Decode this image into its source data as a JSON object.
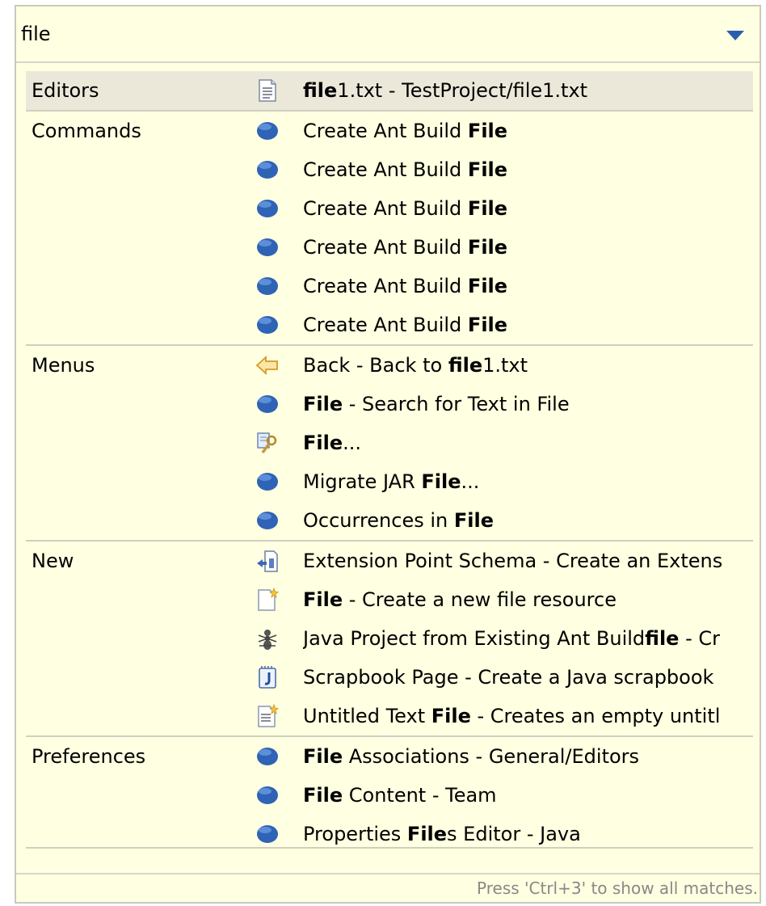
{
  "filter": {
    "value": "file"
  },
  "rows": [
    {
      "category": "Editors",
      "icon": "text-file-icon",
      "selected": true,
      "sep": false,
      "parts": [
        {
          "t": "file",
          "b": true
        },
        {
          "t": "1.txt - TestProject/file1.txt",
          "b": false
        }
      ]
    },
    {
      "category": "Commands",
      "icon": "blue-dot-icon",
      "selected": false,
      "sep": true,
      "parts": [
        {
          "t": "Create Ant Build ",
          "b": false
        },
        {
          "t": "File",
          "b": true
        }
      ]
    },
    {
      "category": "",
      "icon": "blue-dot-icon",
      "selected": false,
      "sep": false,
      "parts": [
        {
          "t": "Create Ant Build ",
          "b": false
        },
        {
          "t": "File",
          "b": true
        }
      ]
    },
    {
      "category": "",
      "icon": "blue-dot-icon",
      "selected": false,
      "sep": false,
      "parts": [
        {
          "t": "Create Ant Build ",
          "b": false
        },
        {
          "t": "File",
          "b": true
        }
      ]
    },
    {
      "category": "",
      "icon": "blue-dot-icon",
      "selected": false,
      "sep": false,
      "parts": [
        {
          "t": "Create Ant Build ",
          "b": false
        },
        {
          "t": "File",
          "b": true
        }
      ]
    },
    {
      "category": "",
      "icon": "blue-dot-icon",
      "selected": false,
      "sep": false,
      "parts": [
        {
          "t": "Create Ant Build ",
          "b": false
        },
        {
          "t": "File",
          "b": true
        }
      ]
    },
    {
      "category": "",
      "icon": "blue-dot-icon",
      "selected": false,
      "sep": false,
      "parts": [
        {
          "t": "Create Ant Build ",
          "b": false
        },
        {
          "t": "File",
          "b": true
        }
      ]
    },
    {
      "category": "Menus",
      "icon": "back-arrow-icon",
      "selected": false,
      "sep": true,
      "parts": [
        {
          "t": "Back - Back to ",
          "b": false
        },
        {
          "t": "file",
          "b": true
        },
        {
          "t": "1.txt",
          "b": false
        }
      ]
    },
    {
      "category": "",
      "icon": "blue-dot-icon",
      "selected": false,
      "sep": false,
      "parts": [
        {
          "t": "File",
          "b": true
        },
        {
          "t": " - Search for Text in File",
          "b": false
        }
      ]
    },
    {
      "category": "",
      "icon": "file-search-icon",
      "selected": false,
      "sep": false,
      "parts": [
        {
          "t": "File",
          "b": true
        },
        {
          "t": "...",
          "b": false
        }
      ]
    },
    {
      "category": "",
      "icon": "blue-dot-icon",
      "selected": false,
      "sep": false,
      "parts": [
        {
          "t": "Migrate JAR ",
          "b": false
        },
        {
          "t": "File",
          "b": true
        },
        {
          "t": "...",
          "b": false
        }
      ]
    },
    {
      "category": "",
      "icon": "blue-dot-icon",
      "selected": false,
      "sep": false,
      "parts": [
        {
          "t": "Occurrences in ",
          "b": false
        },
        {
          "t": "File",
          "b": true
        }
      ]
    },
    {
      "category": "New",
      "icon": "extension-point-icon",
      "selected": false,
      "sep": true,
      "parts": [
        {
          "t": "Extension Point Schema - Create an Extens",
          "b": false
        }
      ]
    },
    {
      "category": "",
      "icon": "new-file-icon",
      "selected": false,
      "sep": false,
      "parts": [
        {
          "t": "File",
          "b": true
        },
        {
          "t": " - Create a new file resource",
          "b": false
        }
      ]
    },
    {
      "category": "",
      "icon": "ant-icon",
      "selected": false,
      "sep": false,
      "parts": [
        {
          "t": "Java Project from Existing Ant Build",
          "b": false
        },
        {
          "t": "file",
          "b": true
        },
        {
          "t": " - Cr",
          "b": false
        }
      ]
    },
    {
      "category": "",
      "icon": "java-scrapbook-icon",
      "selected": false,
      "sep": false,
      "parts": [
        {
          "t": "Scrapbook Page - Create a Java scrapbook",
          "b": false
        }
      ]
    },
    {
      "category": "",
      "icon": "untitled-text-file-icon",
      "selected": false,
      "sep": false,
      "parts": [
        {
          "t": "Untitled Text ",
          "b": false
        },
        {
          "t": "File",
          "b": true
        },
        {
          "t": " - Creates an empty untitl",
          "b": false
        }
      ]
    },
    {
      "category": "Preferences",
      "icon": "blue-dot-icon",
      "selected": false,
      "sep": true,
      "parts": [
        {
          "t": "File",
          "b": true
        },
        {
          "t": " Associations - General/Editors",
          "b": false
        }
      ]
    },
    {
      "category": "",
      "icon": "blue-dot-icon",
      "selected": false,
      "sep": false,
      "parts": [
        {
          "t": "File",
          "b": true
        },
        {
          "t": " Content - Team",
          "b": false
        }
      ]
    },
    {
      "category": "",
      "icon": "blue-dot-icon",
      "selected": false,
      "sep": false,
      "parts": [
        {
          "t": "Properties ",
          "b": false
        },
        {
          "t": "File",
          "b": true
        },
        {
          "t": "s Editor - Java",
          "b": false
        }
      ]
    }
  ],
  "footer": {
    "hint": "Press 'Ctrl+3' to show all matches."
  },
  "colors": {
    "background": "#ffffe1",
    "selection": "#ebe8d9",
    "separator": "#cfcfc1",
    "dot": "#2f63b6",
    "hint": "#888888"
  }
}
